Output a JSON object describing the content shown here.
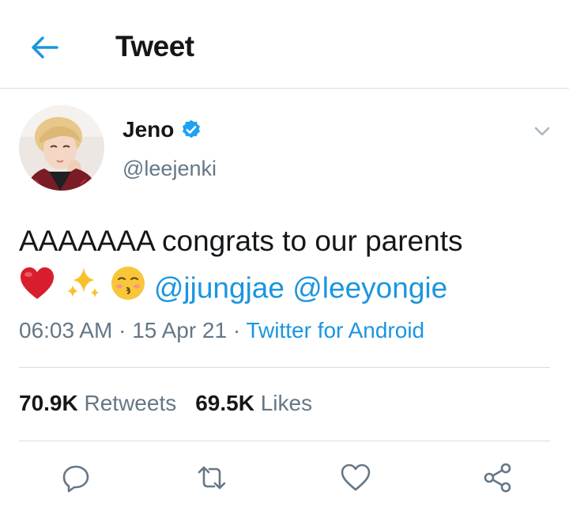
{
  "header": {
    "title": "Tweet",
    "back_icon": "arrow-left-icon"
  },
  "author": {
    "name": "Jeno",
    "handle": "@leejenki",
    "verified": true
  },
  "tweet": {
    "text": "AAAAAAA congrats to our parents",
    "emojis": [
      "red-heart-icon",
      "sparkles-icon",
      "kissing-face-icon"
    ],
    "mentions": [
      "@jjungjae",
      "@leeyongie"
    ]
  },
  "meta": {
    "time": "06:03 AM",
    "separator": "·",
    "date": "15 Apr 21",
    "source": "Twitter for Android"
  },
  "stats": {
    "retweets_count": "70.9K",
    "retweets_label": "Retweets",
    "likes_count": "69.5K",
    "likes_label": "Likes"
  },
  "actions": [
    "reply-icon",
    "retweet-icon",
    "like-icon",
    "share-icon"
  ],
  "colors": {
    "accent": "#1b95e0",
    "secondary_text": "#657786",
    "divider": "#d7dde2",
    "verified": "#1da1f2"
  }
}
